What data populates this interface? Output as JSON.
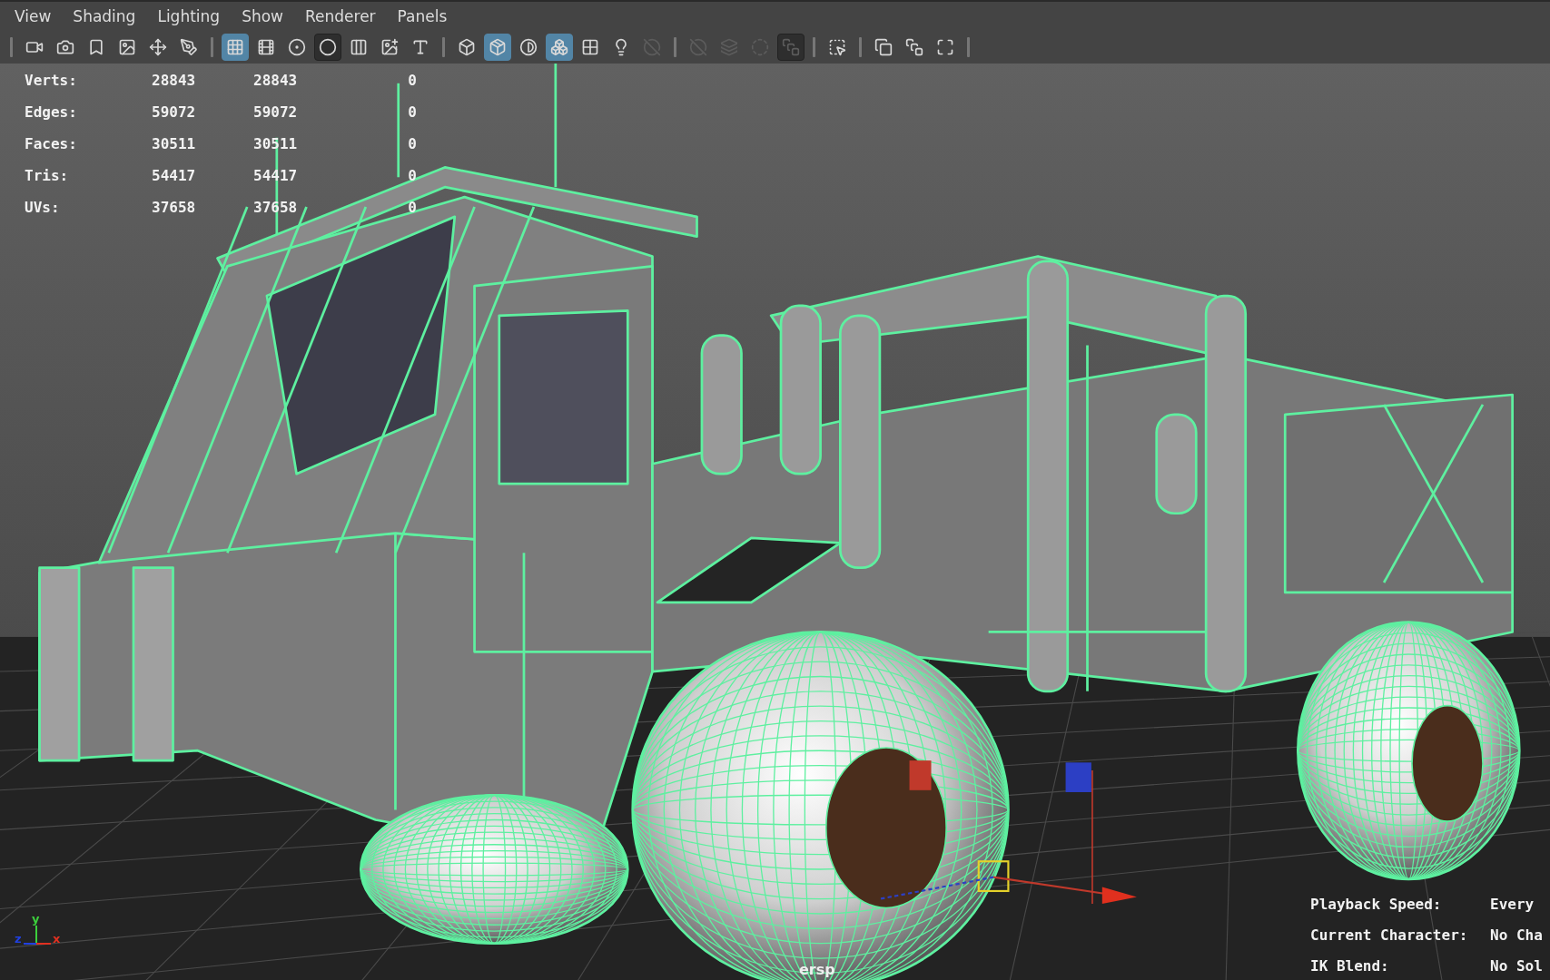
{
  "menu": [
    "View",
    "Shading",
    "Lighting",
    "Show",
    "Renderer",
    "Panels"
  ],
  "toolbar": [
    [
      {
        "selected": false,
        "pressed": false,
        "disabled": false
      },
      {
        "selected": false,
        "pressed": false,
        "disabled": false
      },
      {
        "selected": false,
        "pressed": false,
        "disabled": false
      },
      {
        "selected": false,
        "pressed": false,
        "disabled": false
      },
      {
        "selected": false,
        "pressed": false,
        "disabled": false
      },
      {
        "selected": false,
        "pressed": false,
        "disabled": false
      }
    ],
    [
      {
        "selected": true,
        "pressed": false,
        "disabled": false
      },
      {
        "selected": false,
        "pressed": false,
        "disabled": false
      },
      {
        "selected": false,
        "pressed": false,
        "disabled": false
      },
      {
        "selected": false,
        "pressed": true,
        "disabled": false
      },
      {
        "selected": false,
        "pressed": false,
        "disabled": false
      },
      {
        "selected": false,
        "pressed": false,
        "disabled": false
      },
      {
        "selected": false,
        "pressed": false,
        "disabled": false
      }
    ],
    [
      {
        "selected": false,
        "pressed": false,
        "disabled": false
      },
      {
        "selected": true,
        "pressed": false,
        "disabled": false
      },
      {
        "selected": false,
        "pressed": false,
        "disabled": false
      },
      {
        "selected": true,
        "pressed": false,
        "disabled": false
      },
      {
        "selected": false,
        "pressed": false,
        "disabled": false
      },
      {
        "selected": false,
        "pressed": false,
        "disabled": false
      },
      {
        "selected": false,
        "pressed": false,
        "disabled": true
      }
    ],
    [
      {
        "selected": false,
        "pressed": false,
        "disabled": true
      },
      {
        "selected": false,
        "pressed": false,
        "disabled": true
      },
      {
        "selected": false,
        "pressed": false,
        "disabled": true
      },
      {
        "selected": false,
        "pressed": true,
        "disabled": true
      }
    ],
    [
      {
        "selected": false,
        "pressed": false,
        "disabled": false
      }
    ],
    [
      {
        "selected": false,
        "pressed": false,
        "disabled": false
      },
      {
        "selected": false,
        "pressed": false,
        "disabled": false
      },
      {
        "selected": false,
        "pressed": false,
        "disabled": false
      }
    ]
  ],
  "stats": [
    {
      "label": "Verts:",
      "values": [
        "28843",
        "28843",
        "0"
      ]
    },
    {
      "label": "Edges:",
      "values": [
        "59072",
        "59072",
        "0"
      ]
    },
    {
      "label": "Faces:",
      "values": [
        "30511",
        "30511",
        "0"
      ]
    },
    {
      "label": "Tris:",
      "values": [
        "54417",
        "54417",
        "0"
      ]
    },
    {
      "label": "UVs:",
      "values": [
        "37658",
        "37658",
        "0"
      ]
    }
  ],
  "camera_label": "ersp",
  "axis_labels": [
    "y",
    "z",
    "x"
  ],
  "hud": [
    {
      "label": "Playback Speed:",
      "value": "Every"
    },
    {
      "label": "Current Character:",
      "value": "No Cha"
    },
    {
      "label": "IK Blend:",
      "value": "No Sol"
    }
  ]
}
